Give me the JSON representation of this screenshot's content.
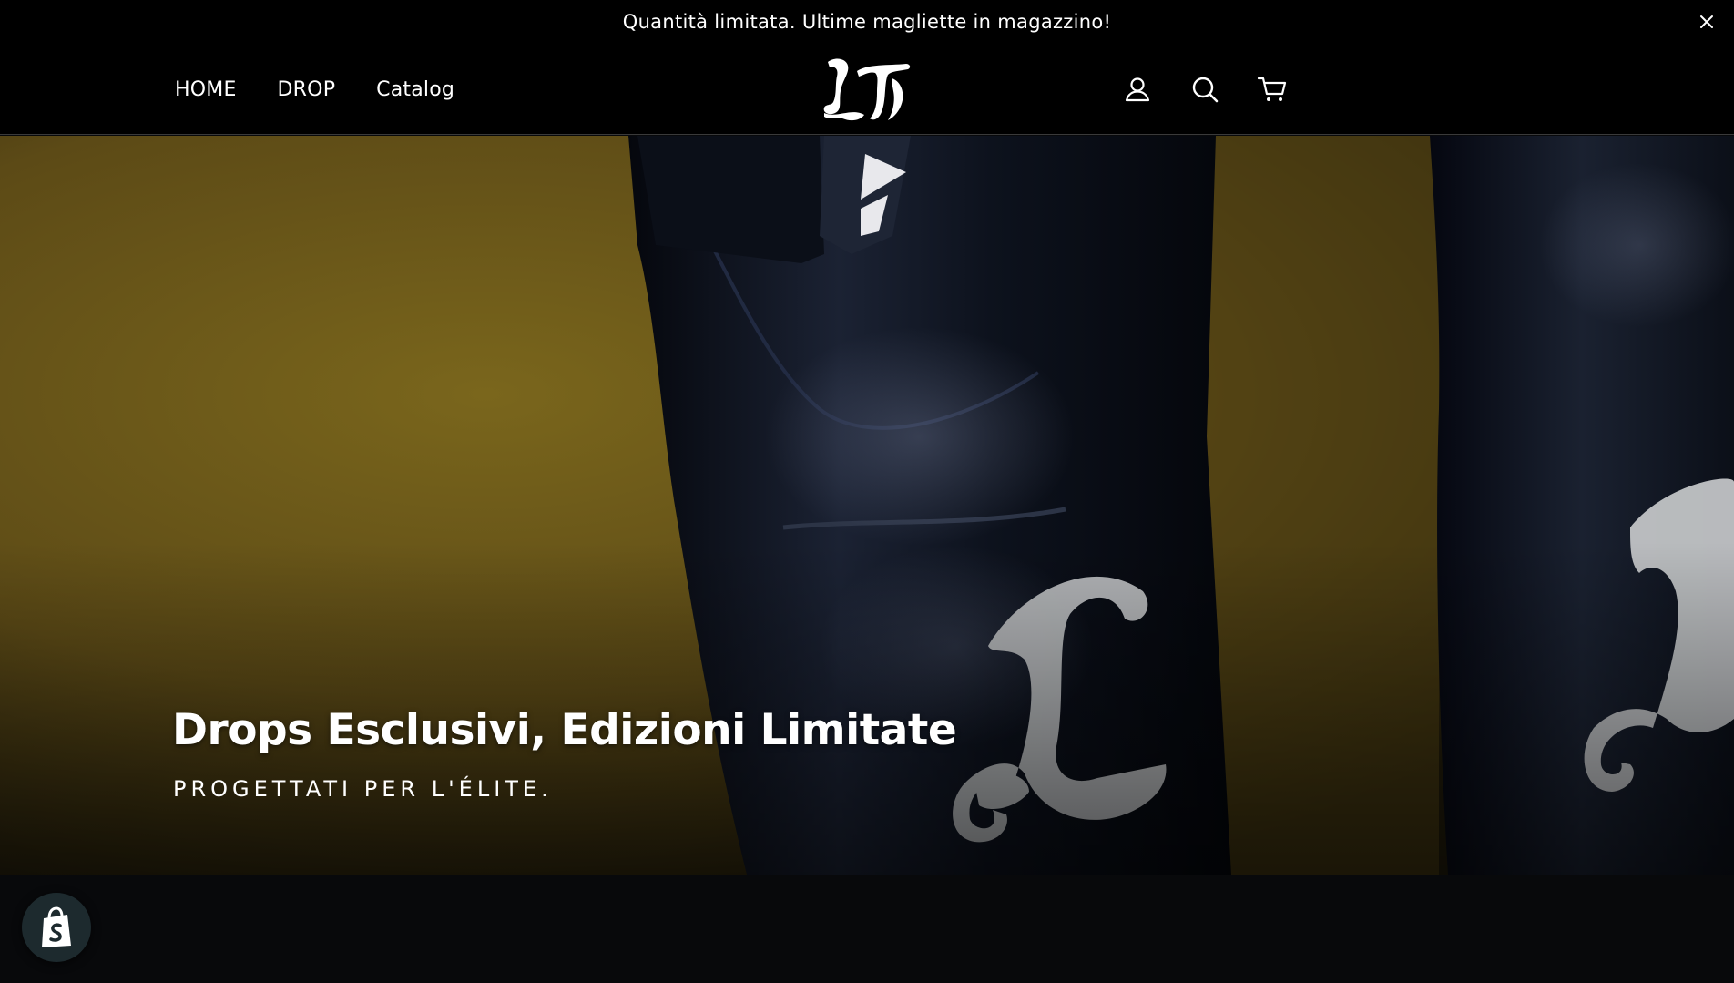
{
  "announcement": {
    "text": "Quantità limitata. Ultime magliette in magazzino!",
    "close_icon": "close-icon"
  },
  "header": {
    "nav": [
      {
        "label": "HOME"
      },
      {
        "label": "DROP"
      },
      {
        "label": "Catalog"
      }
    ],
    "logo_text": "LT",
    "icons": [
      "account-icon",
      "search-icon",
      "cart-icon"
    ]
  },
  "hero": {
    "title": "Drops Esclusivi, Edizioni Limitate",
    "subtitle": "PROGETTATI PER L'ÉLITE."
  },
  "shopify_badge": {
    "icon": "shopify-bag-icon"
  },
  "colors": {
    "header_bg": "#000000",
    "hero_wall": "#6b5718",
    "leather": "#101521",
    "page_bg": "#08090b"
  }
}
